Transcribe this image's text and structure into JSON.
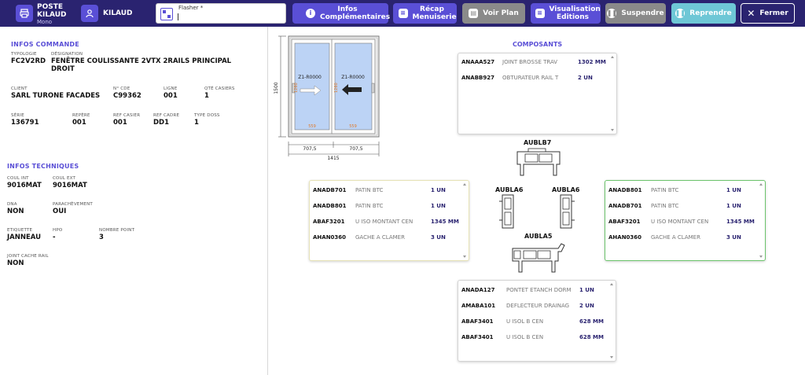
{
  "topbar": {
    "station_title": "POSTE KILAUD",
    "station_subtitle": "Mono",
    "user_name": "KILAUD",
    "flasher_label": "Flasher *",
    "flasher_value": "",
    "buttons": {
      "infos": "Infos Complémentaires",
      "recap": "Récap Menuiserie",
      "voir_plan": "Voir Plan",
      "visualisation": "Visualisation Editions",
      "suspendre": "Suspendre",
      "reprendre": "Reprendre",
      "fermer": "Fermer"
    },
    "colors": {
      "bar": "#2a2370",
      "accent": "#5a4fd6",
      "disabled": "#8a8a8a",
      "resume": "#6ec7d6"
    }
  },
  "commande": {
    "title": "INFOS COMMANDE",
    "fields": [
      {
        "label": "TYPOLOGIE",
        "value": "FC2V2RD"
      },
      {
        "label": "DÉSIGNATION",
        "value": "FENÊTRE COULISSANTE 2VTX 2RAILS PRINCIPAL DROIT"
      },
      {
        "label": "CLIENT",
        "value": "SARL TURONE FACADES"
      },
      {
        "label": "N° CDE",
        "value": "C99362"
      },
      {
        "label": "LIGNE",
        "value": "001"
      },
      {
        "label": "QTÉ CASIERS",
        "value": "1"
      },
      {
        "label": "SÉRIE",
        "value": "136791"
      },
      {
        "label": "REPÈRE",
        "value": "001"
      },
      {
        "label": "REF CASIER",
        "value": "001"
      },
      {
        "label": "REF CADRE",
        "value": "DD1"
      },
      {
        "label": "TYPE DOSS",
        "value": "1"
      }
    ]
  },
  "techniques": {
    "title": "INFOS TECHNIQUES",
    "fields": [
      {
        "label": "COUL INT",
        "value": "9016MAT"
      },
      {
        "label": "COUL EXT",
        "value": "9016MAT"
      },
      {
        "label": "DNA",
        "value": "NON"
      },
      {
        "label": "PARACHÈVEMENT",
        "value": "OUI"
      },
      {
        "label": "ETIQUETTE",
        "value": "JANNEAU"
      },
      {
        "label": "HPO",
        "value": "-"
      },
      {
        "label": "NOMBRE POINT",
        "value": "3"
      },
      {
        "label": "JOINT CACHE RAIL",
        "value": "NON"
      }
    ]
  },
  "drawing": {
    "height": "1500",
    "width_left": "707,5",
    "width_right": "707,5",
    "width_total": "1415",
    "leaf_label": "Z1-R0000",
    "glass_height": "1260",
    "glass_width": "559"
  },
  "composants": {
    "title": "COMPOSANTS",
    "top_card": [
      {
        "code": "ANAAA527",
        "desc": "JOINT BROSSE TRAV",
        "qty": "1302 MM"
      },
      {
        "code": "ANABB927",
        "desc": "OBTURATEUR RAIL T",
        "qty": "2 UN"
      }
    ],
    "left_card": [
      {
        "code": "ANADB701",
        "desc": "PATIN BTC",
        "qty": "1 UN"
      },
      {
        "code": "ANADB801",
        "desc": "PATIN BTC",
        "qty": "1 UN"
      },
      {
        "code": "ABAF3201",
        "desc": "U ISO MONTANT CEN",
        "qty": "1345 MM"
      },
      {
        "code": "AHAN0360",
        "desc": "GACHE A CLAMER",
        "qty": "3 UN"
      }
    ],
    "right_card": [
      {
        "code": "ANADB801",
        "desc": "PATIN BTC",
        "qty": "1 UN"
      },
      {
        "code": "ANADB701",
        "desc": "PATIN BTC",
        "qty": "1 UN"
      },
      {
        "code": "ABAF3201",
        "desc": "U ISO MONTANT CEN",
        "qty": "1345 MM"
      },
      {
        "code": "AHAN0360",
        "desc": "GACHE A CLAMER",
        "qty": "3 UN"
      }
    ],
    "bottom_card": [
      {
        "code": "ANADA127",
        "desc": "PONTET ETANCH DORM",
        "qty": "1 UN"
      },
      {
        "code": "AMABA101",
        "desc": "DEFLECTEUR DRAINAG",
        "qty": "2 UN"
      },
      {
        "code": "ABAF3401",
        "desc": "U ISOL B CEN",
        "qty": "628 MM"
      },
      {
        "code": "ABAF3401",
        "desc": "U ISOL B CEN",
        "qty": "628 MM"
      }
    ],
    "profiles": {
      "top": "AUBLB7",
      "left": "AUBLA6",
      "right": "AUBLA6",
      "bottom": "AUBLA5"
    }
  }
}
